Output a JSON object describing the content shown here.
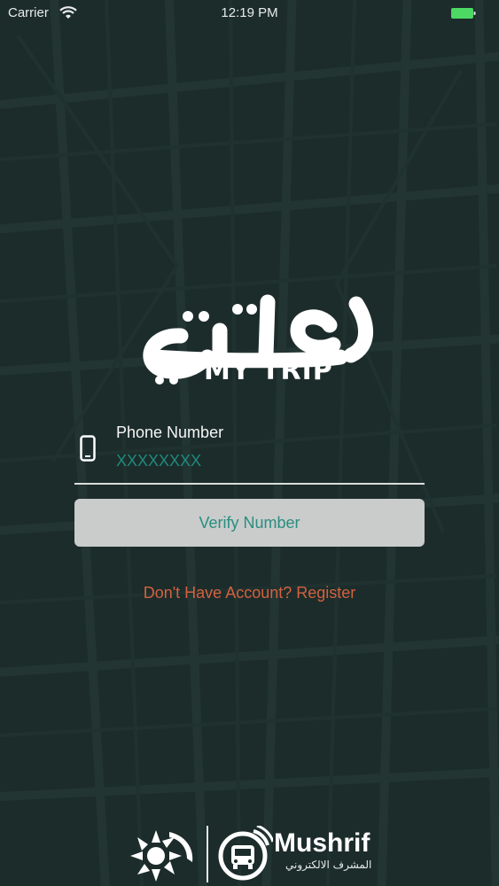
{
  "status_bar": {
    "carrier": "Carrier",
    "time": "12:19 PM",
    "battery_color": "#4cd964"
  },
  "logo": {
    "english": "MY TRIP"
  },
  "phone_form": {
    "label": "Phone Number",
    "placeholder": "XXXXXXXX",
    "value": "",
    "icon": "mobile-phone-icon"
  },
  "verify_button": {
    "label": "Verify Number"
  },
  "register_link": {
    "text": "Don't Have Account? Register"
  },
  "footer": {
    "brand_name": "Mushrif",
    "brand_subtitle": "المشرف الالكتروني"
  },
  "colors": {
    "background": "#1c2c2a",
    "accent": "#2a8d81",
    "button_bg": "#c9cccb",
    "link": "#d3613f"
  }
}
